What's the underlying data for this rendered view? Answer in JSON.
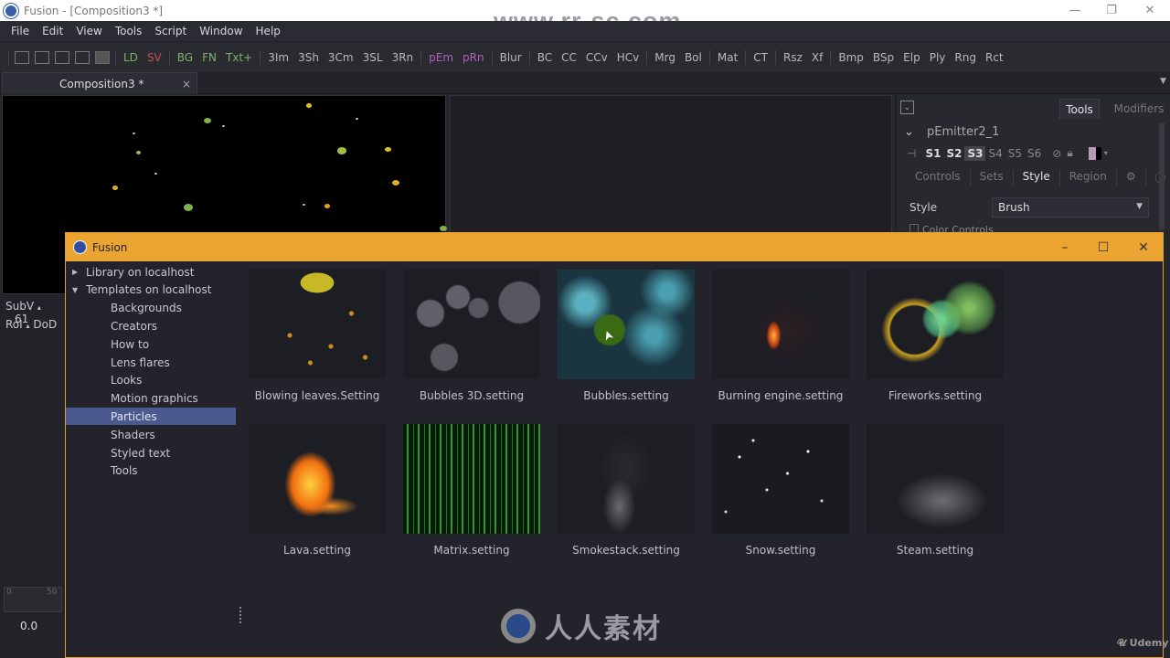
{
  "window": {
    "title": "Fusion - [Composition3 *]",
    "controls": {
      "minimize": "—",
      "restore": "❐",
      "close": "✕"
    }
  },
  "watermark": {
    "top_url": "www.rr-sc.com",
    "bottom_logo_text": "人人素材",
    "corner": "Udemy"
  },
  "menubar": {
    "items": [
      "File",
      "Edit",
      "View",
      "Tools",
      "Script",
      "Window",
      "Help"
    ]
  },
  "toolbar": {
    "layout_icons": [
      "layout-single-icon",
      "layout-split-v-icon",
      "layout-split-h-icon",
      "layout-quad-icon",
      "lock-icon"
    ],
    "groups": [
      [
        {
          "label": "LD",
          "color": "#7fb069"
        },
        {
          "label": "SV",
          "color": "#c05050"
        }
      ],
      [
        {
          "label": "BG",
          "color": "#7fb069"
        },
        {
          "label": "FN",
          "color": "#7fb069"
        },
        {
          "label": "Txt+",
          "color": "#7fb069"
        }
      ],
      [
        {
          "label": "3Im",
          "color": "#b8b8c0"
        },
        {
          "label": "3Sh",
          "color": "#b8b8c0"
        },
        {
          "label": "3Cm",
          "color": "#b8b8c0"
        },
        {
          "label": "3SL",
          "color": "#b8b8c0"
        },
        {
          "label": "3Rn",
          "color": "#b8b8c0"
        }
      ],
      [
        {
          "label": "pEm",
          "color": "#b060c0"
        },
        {
          "label": "pRn",
          "color": "#b060c0"
        }
      ],
      [
        {
          "label": "Blur",
          "color": "#b8b8c0"
        }
      ],
      [
        {
          "label": "BC",
          "color": "#b8b8c0"
        },
        {
          "label": "CC",
          "color": "#b8b8c0"
        },
        {
          "label": "CCv",
          "color": "#b8b8c0"
        },
        {
          "label": "HCv",
          "color": "#b8b8c0"
        }
      ],
      [
        {
          "label": "Mrg",
          "color": "#b8b8c0"
        },
        {
          "label": "Bol",
          "color": "#b8b8c0"
        }
      ],
      [
        {
          "label": "Mat",
          "color": "#b8b8c0"
        }
      ],
      [
        {
          "label": "CT",
          "color": "#b8b8c0"
        }
      ],
      [
        {
          "label": "Rsz",
          "color": "#b8b8c0"
        },
        {
          "label": "Xf",
          "color": "#b8b8c0"
        }
      ],
      [
        {
          "label": "Bmp",
          "color": "#b8b8c0"
        },
        {
          "label": "BSp",
          "color": "#b8b8c0"
        },
        {
          "label": "Elp",
          "color": "#b8b8c0"
        },
        {
          "label": "Ply",
          "color": "#b8b8c0"
        },
        {
          "label": "Rng",
          "color": "#b8b8c0"
        },
        {
          "label": "Rct",
          "color": "#b8b8c0"
        }
      ]
    ]
  },
  "doc_tab": {
    "label": "Composition3 *",
    "close": "×"
  },
  "left_strip": {
    "row1": [
      "SubV",
      "▴",
      "61"
    ],
    "row2": [
      "RoI",
      "▴",
      "DoD"
    ],
    "ruler_ticks": [
      "0",
      "50"
    ],
    "value": "0.0"
  },
  "inspector": {
    "tabs": [
      {
        "label": "Tools",
        "active": true
      },
      {
        "label": "Modifiers",
        "active": false
      }
    ],
    "tool_name": "pEmitter2_1",
    "slots": [
      "S1",
      "S2",
      "S3",
      "S4",
      "S5",
      "S6"
    ],
    "selected_slot": "S3",
    "control_tabs": [
      "Controls",
      "Sets",
      "Style",
      "Region"
    ],
    "active_control_tab": "Style",
    "style_label": "Style",
    "style_value": "Brush",
    "color_controls_label": "Color Controls"
  },
  "dialog": {
    "title": "Fusion",
    "accent": "#eba332",
    "tree": [
      {
        "label": "Library on localhost",
        "level": 0,
        "expanded": false
      },
      {
        "label": "Templates on localhost",
        "level": 0,
        "expanded": true
      },
      {
        "label": "Backgrounds",
        "level": 1
      },
      {
        "label": "Creators",
        "level": 1
      },
      {
        "label": "How to",
        "level": 1
      },
      {
        "label": "Lens flares",
        "level": 1
      },
      {
        "label": "Looks",
        "level": 1
      },
      {
        "label": "Motion graphics",
        "level": 1
      },
      {
        "label": "Particles",
        "level": 1,
        "selected": true
      },
      {
        "label": "Shaders",
        "level": 1
      },
      {
        "label": "Styled text",
        "level": 1
      },
      {
        "label": "Tools",
        "level": 1
      }
    ],
    "templates": [
      {
        "name": "Blowing leaves.Setting",
        "thumb": "leaves"
      },
      {
        "name": "Bubbles 3D.setting",
        "thumb": "bubbles3d"
      },
      {
        "name": "Bubbles.setting",
        "thumb": "bubbles"
      },
      {
        "name": "Burning engine.setting",
        "thumb": "engine"
      },
      {
        "name": "Fireworks.setting",
        "thumb": "fireworks"
      },
      {
        "name": "Lava.setting",
        "thumb": "lava"
      },
      {
        "name": "Matrix.setting",
        "thumb": "matrix"
      },
      {
        "name": "Smokestack.setting",
        "thumb": "smoke"
      },
      {
        "name": "Snow.setting",
        "thumb": "snow"
      },
      {
        "name": "Steam.setting",
        "thumb": "steam"
      }
    ]
  }
}
